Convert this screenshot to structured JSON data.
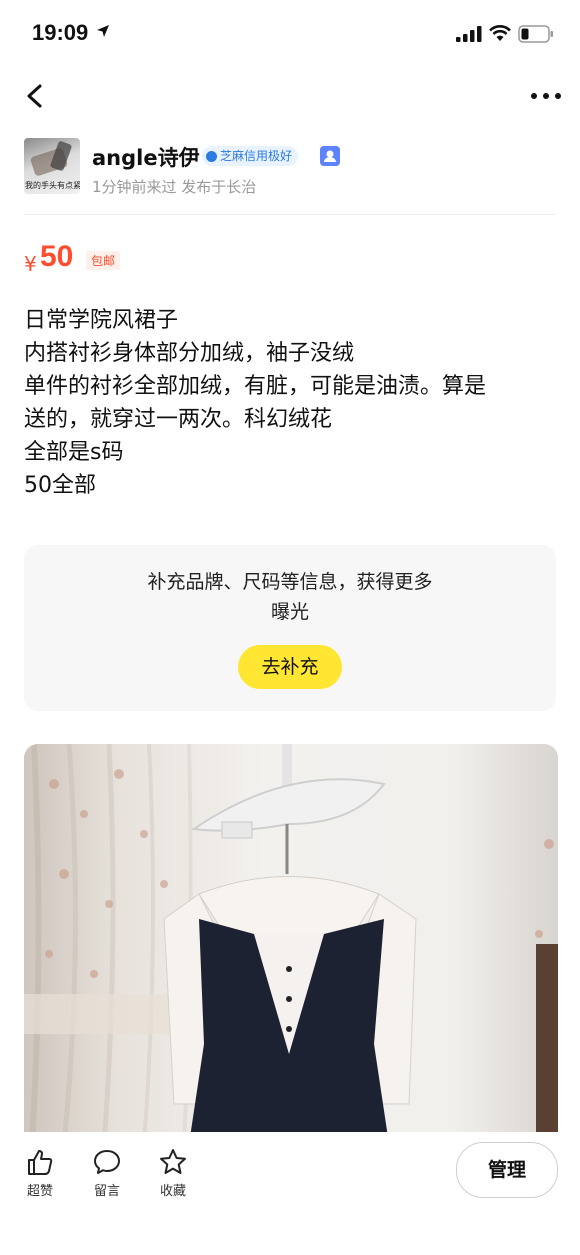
{
  "status_bar": {
    "time": "19:09"
  },
  "seller": {
    "avatar_caption": "我的手头有点紧",
    "name": "angle诗伊",
    "credit_badge": "芝麻信用极好",
    "meta": "1分钟前来过 发布于长治"
  },
  "listing": {
    "currency": "¥",
    "price": "50",
    "shipping_tag": "包邮",
    "description_lines": [
      "日常学院风裙子",
      "内搭衬衫身体部分加绒，袖子没绒",
      "单件的衬衫全部加绒，有脏，可能是油渍。算是",
      "送的，就穿过一两次。科幻绒花",
      "全部是s码",
      "50全部"
    ]
  },
  "supplement": {
    "lines": [
      "补充品牌、尺码等信息，获得更多",
      "曝光"
    ],
    "button_label": "去补充"
  },
  "bottom_bar": {
    "like_label": "超赞",
    "comment_label": "留言",
    "favorite_label": "收藏",
    "manage_label": "管理"
  }
}
